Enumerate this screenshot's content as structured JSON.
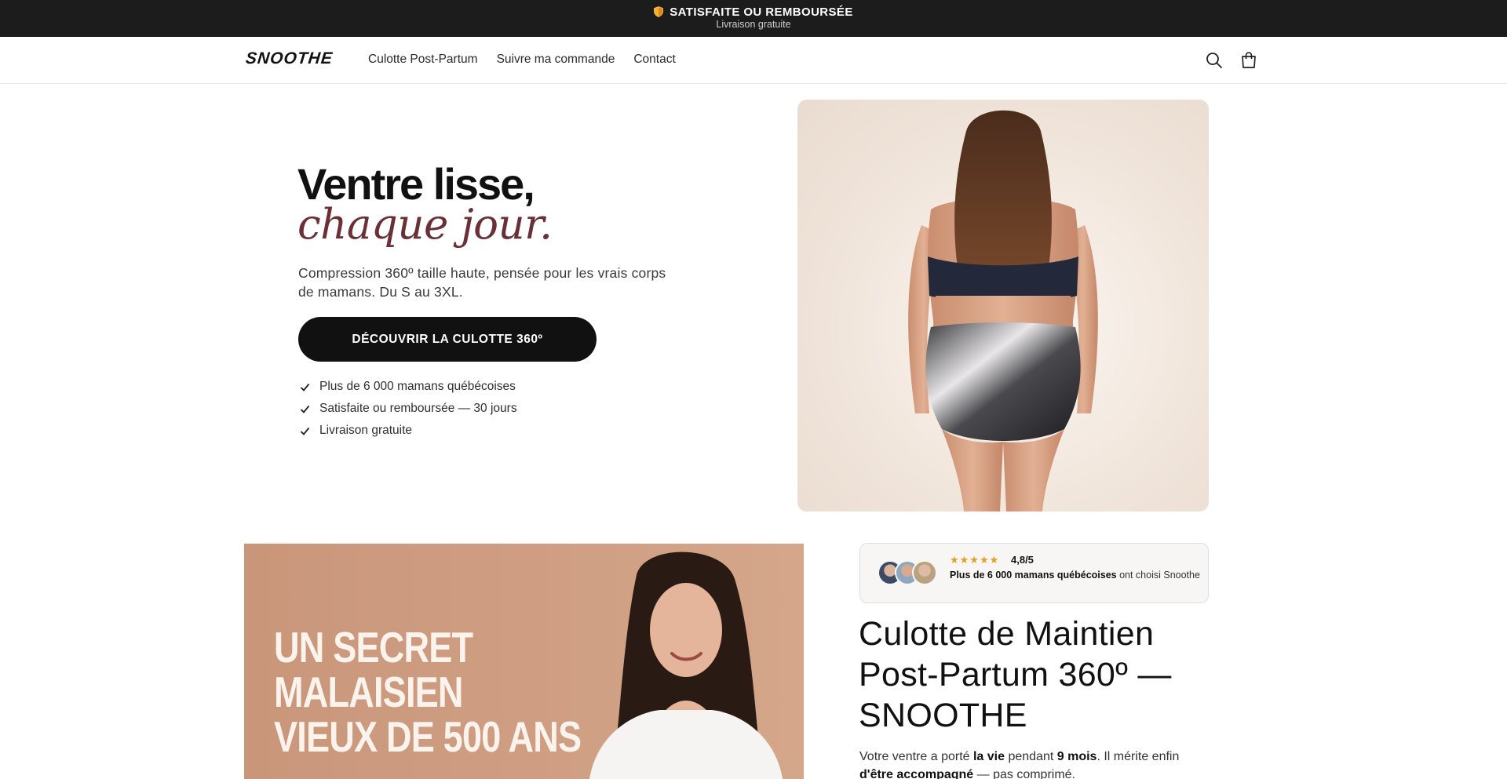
{
  "announcement": {
    "title": "SATISFAITE OU REMBOURSÉE",
    "subtitle": "Livraison gratuite",
    "icon": "shield-icon"
  },
  "header": {
    "logo": "SNOOTHE",
    "nav": [
      "Culotte Post-Partum",
      "Suivre ma commande",
      "Contact"
    ],
    "icons": [
      "search-icon",
      "cart-icon"
    ]
  },
  "hero": {
    "title_line1": "Ventre lisse,",
    "title_line2": "chaque jour.",
    "subtitle": "Compression 360º taille haute, pensée pour les vrais corps de mamans. Du S au 3XL.",
    "cta": "DÉCOUVRIR LA CULOTTE 360º",
    "checks": [
      "Plus de 6 000 mamans québécoises",
      "Satisfaite ou remboursée — 30 jours",
      "Livraison gratuite"
    ]
  },
  "promo": {
    "lines": [
      "UN SECRET",
      "MALAISIEN",
      "VIEUX DE 500 ANS"
    ]
  },
  "review": {
    "stars": "★★★★★",
    "rating": "4,8/5",
    "text_bold": "Plus de 6 000 mamans québécoises",
    "text_rest": " ont choisi Snoothe"
  },
  "product": {
    "title": "Culotte de Maintien Post-Partum 360º — SNOOTHE",
    "desc_1": "Votre ventre a porté ",
    "desc_b1": "la vie",
    "desc_2": " pendant ",
    "desc_b2": "9 mois",
    "desc_3": ". Il mérite enfin ",
    "desc_b3": "d'être accompagné",
    "desc_4": " — pas comprimé."
  },
  "colors": {
    "accent_wine": "#6b2f36",
    "dark": "#1c1c1c",
    "star": "#e79d1f"
  }
}
